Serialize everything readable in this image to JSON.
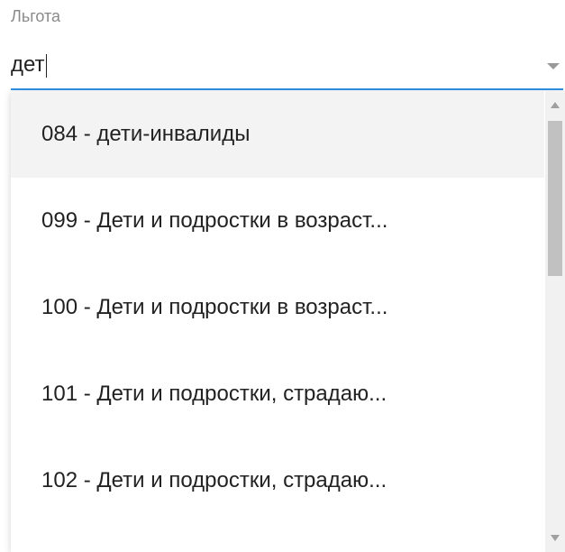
{
  "field": {
    "label": "Льгота",
    "value": "дет"
  },
  "options": [
    "084 - дети-инвалиды",
    "099 - Дети и подростки в возраст...",
    "100 - Дети и подростки в возраст...",
    "101 - Дети и подростки, страдаю...",
    "102 - Дети и подростки, страдаю..."
  ],
  "colors": {
    "accent": "#2f8fe6",
    "hover": "#f3f3f3"
  }
}
